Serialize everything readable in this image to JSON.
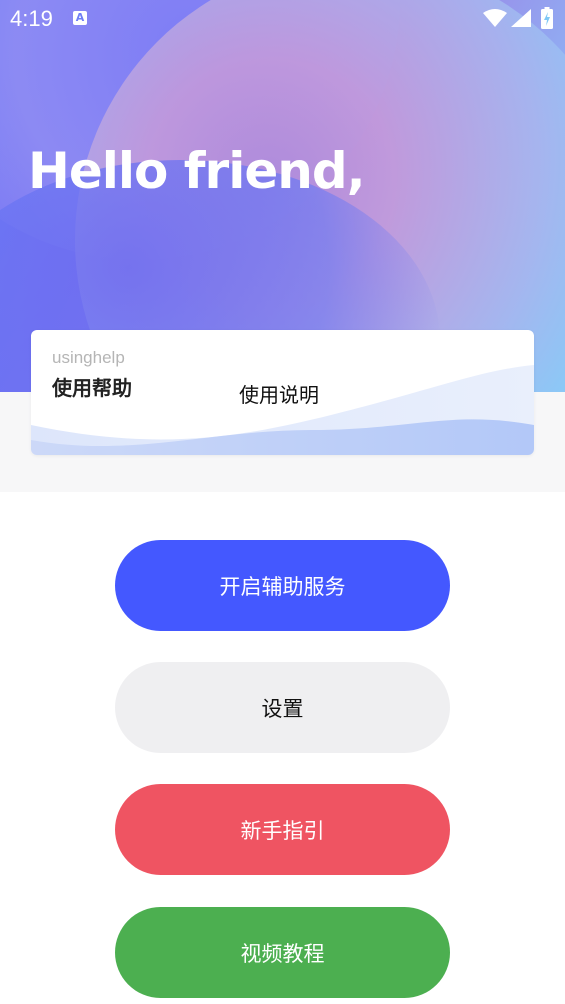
{
  "status_bar": {
    "time": "4:19",
    "notification_icon": "A"
  },
  "hero": {
    "greeting": "Hello friend,"
  },
  "help_card": {
    "english_label": "usinghelp",
    "chinese_label": "使用帮助",
    "link_text": "使用说明"
  },
  "buttons": {
    "accessibility": "开启辅助服务",
    "settings": "设置",
    "guide": "新手指引",
    "video": "视频教程"
  },
  "colors": {
    "accessibility_button": "#4458ff",
    "settings_button": "#efeff1",
    "guide_button": "#ef5462",
    "video_button": "#4caf50"
  }
}
